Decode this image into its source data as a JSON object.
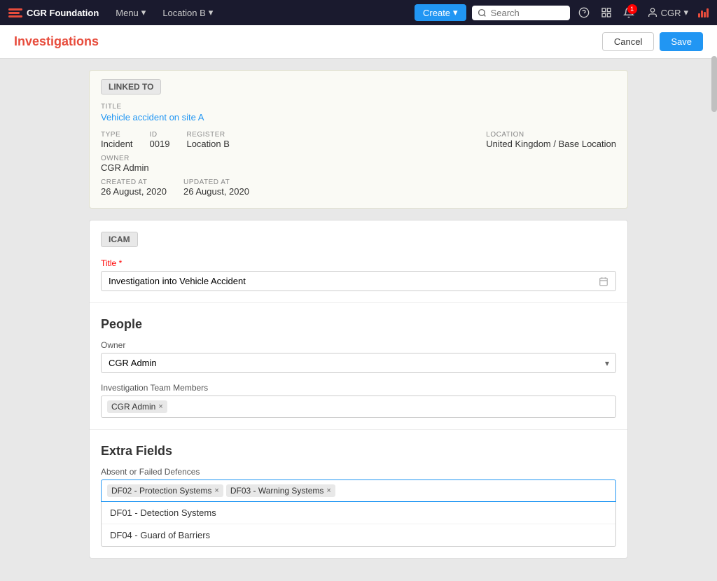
{
  "topnav": {
    "logo_text": "CGR Foundation",
    "menu_label": "Menu",
    "location_label": "Location B",
    "create_label": "Create",
    "search_placeholder": "Search",
    "user_label": "CGR",
    "notification_count": "1"
  },
  "subheader": {
    "title": "Investigations",
    "cancel_label": "Cancel",
    "save_label": "Save"
  },
  "linked_card": {
    "badge_label": "LINKED TO",
    "title_label": "TITLE",
    "title_link": "Vehicle accident on site A",
    "type_label": "TYPE",
    "type_value": "Incident",
    "id_label": "ID",
    "id_value": "0019",
    "register_label": "REGISTER",
    "register_value": "Location B",
    "location_label": "LOCATION",
    "location_value": "United Kingdom / Base Location",
    "owner_label": "OWNER",
    "owner_value": "CGR Admin",
    "created_label": "CREATED AT",
    "created_value": "26 August, 2020",
    "updated_label": "UPDATED AT",
    "updated_value": "26 August, 2020"
  },
  "form_card": {
    "icam_badge": "ICAM",
    "title_field_label": "Title",
    "title_field_required": true,
    "title_field_value": "Investigation into Vehicle Accident",
    "people_heading": "People",
    "owner_label": "Owner",
    "owner_value": "CGR Admin",
    "owner_options": [
      "CGR Admin"
    ],
    "team_label": "Investigation Team Members",
    "team_tags": [
      {
        "label": "CGR Admin"
      }
    ],
    "extra_fields_heading": "Extra Fields",
    "absent_defences_label": "Absent or Failed Defences",
    "absent_tags": [
      {
        "label": "DF02 - Protection Systems"
      },
      {
        "label": "DF03 - Warning Systems"
      }
    ],
    "dropdown_items": [
      "DF01 - Detection Systems",
      "DF04 - Guard of Barriers"
    ]
  }
}
